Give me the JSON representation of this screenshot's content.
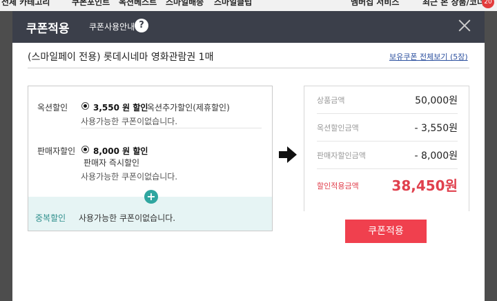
{
  "background_nav": {
    "items": [
      "전체 카테고리",
      "쿠폰포인트",
      "옥션베스트",
      "스마일배송",
      "스마일클럽",
      "멤버십 서비스",
      "최근 본 상품/코너"
    ],
    "badge": "20"
  },
  "modal": {
    "title": "쿠폰적용",
    "guide_link": "쿠폰사용안내",
    "help_icon": "?",
    "product_name": "(스마일페이 전용) 롯데시네마 영화관람권 1매",
    "view_all_link": "보유쿠폰 전체보기 (5장)"
  },
  "coupons": {
    "auction": {
      "label": "옥션할인",
      "amount": "3,550 원 할인",
      "desc": "옥션추가할인(제휴할인)",
      "note": "사용가능한 쿠폰이없습니다."
    },
    "seller": {
      "label": "판매자할인",
      "amount": "8,000 원 할인",
      "desc": "판매자 즉시할인",
      "note": "사용가능한 쿠폰이없습니다."
    },
    "duplicate": {
      "label": "중복할인",
      "note": "사용가능한 쿠폰이없습니다."
    },
    "plus_icon": "+"
  },
  "summary": {
    "product_amount_label": "상품금액",
    "product_amount": "50,000원",
    "auction_discount_label": "옥션할인금액",
    "auction_discount": "- 3,550원",
    "seller_discount_label": "판매자할인금액",
    "seller_discount": "- 8,000원",
    "final_label": "할인적용금액",
    "final_amount": "38,450원"
  },
  "apply_button": "쿠폰적용",
  "colors": {
    "header_bg": "#3b3f4a",
    "accent_red": "#f0404e",
    "teal": "#2fa6a0",
    "dup_bg": "#e6f4f4"
  },
  "icons": {
    "help": "help-circle-icon",
    "close": "close-icon",
    "arrow": "arrow-right-icon",
    "plus": "plus-circle-icon"
  }
}
